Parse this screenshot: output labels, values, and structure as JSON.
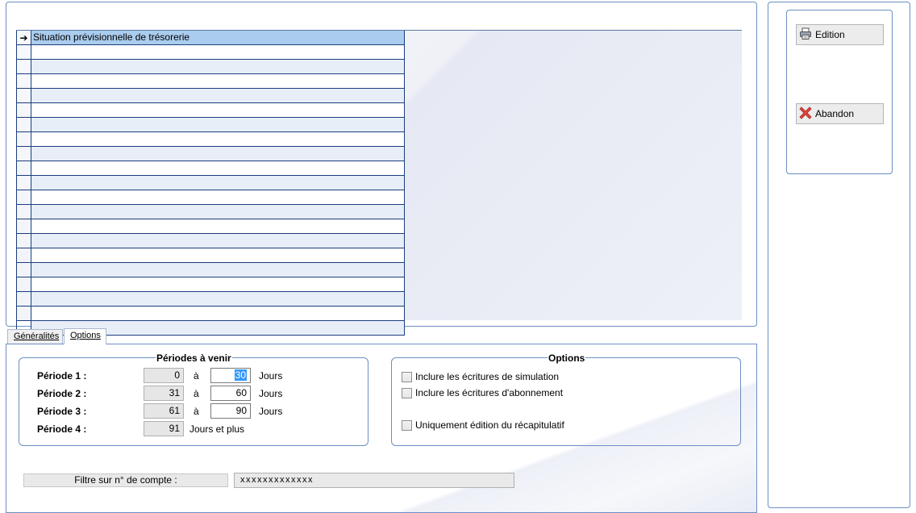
{
  "report_list": {
    "selected_item": "Situation prévisionnelle de trésorerie",
    "row_indicator": "➔"
  },
  "buttons": {
    "edition": "Edition",
    "abandon": "Abandon"
  },
  "tabs": {
    "generalites": "Généralités",
    "options": "Options"
  },
  "periods": {
    "title": "Périodes à venir",
    "connector": "à",
    "unit": "Jours",
    "unit_plus": "Jours et plus",
    "rows": [
      {
        "label": "Période 1 :",
        "from": "0",
        "to": "30"
      },
      {
        "label": "Période 2 :",
        "from": "31",
        "to": "60"
      },
      {
        "label": "Période 3 :",
        "from": "61",
        "to": "90"
      },
      {
        "label": "Période 4 :",
        "from": "91"
      }
    ]
  },
  "options": {
    "title": "Options",
    "include_simulation": "Inclure les écritures de simulation",
    "include_subscription": "Inclure les écritures d'abonnement",
    "summary_only": "Uniquement édition du récapitulatif"
  },
  "filter": {
    "label": "Filtre sur n° de compte :",
    "value": "xxxxxxxxxxxxx"
  }
}
